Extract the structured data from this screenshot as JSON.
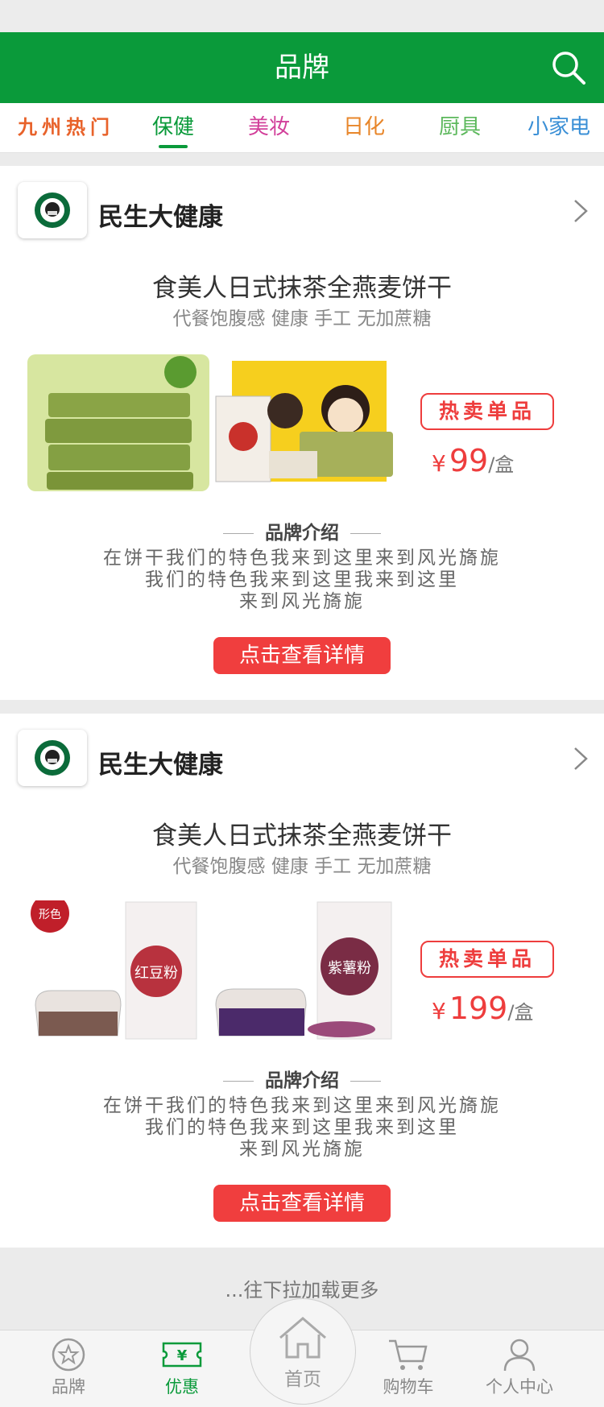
{
  "header": {
    "title": "品牌",
    "search_icon": "search-icon"
  },
  "tabs": [
    {
      "label": "九州热门",
      "color": "#e8622a"
    },
    {
      "label": "保健",
      "color": "#0a9a3a",
      "active": true
    },
    {
      "label": "美妆",
      "color": "#d23f9a"
    },
    {
      "label": "日化",
      "color": "#e8862a"
    },
    {
      "label": "厨具",
      "color": "#5cb85c"
    },
    {
      "label": "小家电",
      "color": "#3a8fd6"
    }
  ],
  "cards": [
    {
      "brand": "民生大健康",
      "title": "食美人日式抹茶全燕麦饼干",
      "subtitle": "代餐饱腹感 健康 手工 无加蔗糖",
      "hot_label": "热卖单品",
      "currency": "¥",
      "price": "99",
      "unit": "/盒",
      "intro_title": "品牌介绍",
      "intro_lines": [
        "在饼干我们的特色我来到这里来到风光旖旎",
        "我们的特色我来到这里我来到这里",
        "来到风光旖旎"
      ],
      "button": "点击查看详情",
      "image": "matcha-biscuits"
    },
    {
      "brand": "民生大健康",
      "title": "食美人日式抹茶全燕麦饼干",
      "subtitle": "代餐饱腹感 健康 手工 无加蔗糖",
      "hot_label": "热卖单品",
      "currency": "¥",
      "price": "199",
      "unit": "/盒",
      "intro_title": "品牌介绍",
      "intro_lines": [
        "在饼干我们的特色我来到这里来到风光旖旎",
        "我们的特色我来到这里我来到这里",
        "来到风光旖旎"
      ],
      "button": "点击查看详情",
      "image": "powder-drinks",
      "image_text": {
        "badge": "形色",
        "box1": "红豆粉",
        "box2": "紫薯粉"
      }
    }
  ],
  "load_more": "...往下拉加载更多",
  "nav": [
    {
      "label": "品牌",
      "icon": "brand-icon"
    },
    {
      "label": "优惠",
      "icon": "coupon-icon",
      "active": true,
      "coupon_symbol": "¥"
    },
    {
      "label": "首页",
      "icon": "home-icon"
    },
    {
      "label": "购物车",
      "icon": "cart-icon"
    },
    {
      "label": "个人中心",
      "icon": "user-icon"
    }
  ],
  "colors": {
    "brand_green": "#0a9a3a",
    "accent_red": "#ee3d3d"
  }
}
